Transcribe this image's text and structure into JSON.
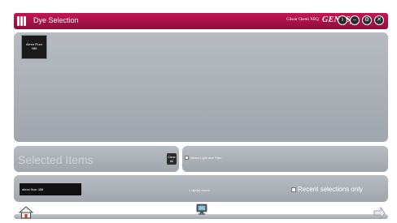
{
  "window": {
    "title": "Dye Selection",
    "instrument": "Gilson Chemi XRQ",
    "brand": "GENESys"
  },
  "titlebar": {
    "buttons": [
      {
        "name": "info",
        "glyph": "i"
      },
      {
        "name": "minimize",
        "glyph": "–"
      },
      {
        "name": "settings",
        "glyph": "⚙"
      },
      {
        "name": "close",
        "glyph": "✕"
      }
    ]
  },
  "dyes": [
    {
      "name": "Alexa Fluor",
      "number": "488"
    }
  ],
  "selected": {
    "title": "Selected Items",
    "clear_line1": "Clear",
    "clear_line2": "All"
  },
  "light_filter": {
    "label": "Select Light and Filter",
    "checked": false
  },
  "search": {
    "value": "alexa fluor 488",
    "found_text": "1 dye(s) found",
    "recent_label": "Recent selections only",
    "recent_checked": false
  },
  "colors": {
    "title_bar": "#b0124a",
    "panel": "#a9aeb4"
  },
  "icons": {
    "home": "home-icon",
    "center": "camera-icon",
    "next": "next-icon"
  }
}
